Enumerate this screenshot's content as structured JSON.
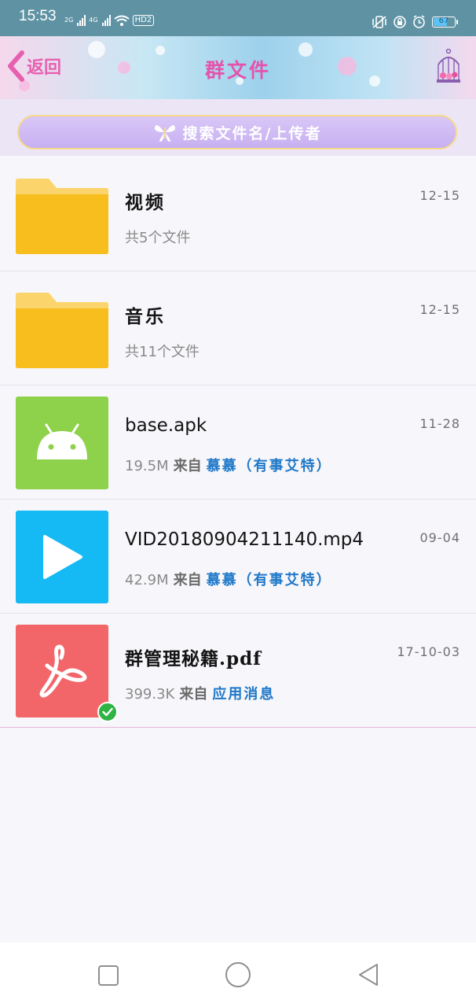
{
  "status_bar": {
    "time": "15:53",
    "network_1": "2G",
    "network_2": "4G",
    "hd_label": "HD2",
    "battery": "67",
    "battery_level": 0.67
  },
  "header": {
    "back_label": "返回",
    "title": "群文件",
    "accent_color": "#e553ac"
  },
  "search": {
    "placeholder": "搜索文件名/上传者"
  },
  "files": [
    {
      "name": "视频",
      "date": "12-15",
      "meta": "共5个文件",
      "type": "folder"
    },
    {
      "name": "音乐",
      "date": "12-15",
      "meta": "共11个文件",
      "type": "folder"
    },
    {
      "name": "base.apk",
      "date": "11-28",
      "size": "19.5M",
      "from": "来自",
      "source": "慕慕（有事艾特）",
      "type": "apk",
      "color": "#8ed14a"
    },
    {
      "name": "VID20180904211140.mp4",
      "date": "09-04",
      "size": "42.9M",
      "from": "来自",
      "source": "慕慕（有事艾特）",
      "type": "video",
      "color": "#15b9f3"
    },
    {
      "name": "群管理秘籍.pdf",
      "date": "17-10-03",
      "size": "399.3K",
      "from": "来自",
      "source": "应用消息",
      "type": "pdf",
      "color": "#f2666a",
      "downloaded": true
    }
  ],
  "nav": {
    "recent": "recent-apps-icon",
    "home": "home-icon",
    "back": "back-icon"
  }
}
